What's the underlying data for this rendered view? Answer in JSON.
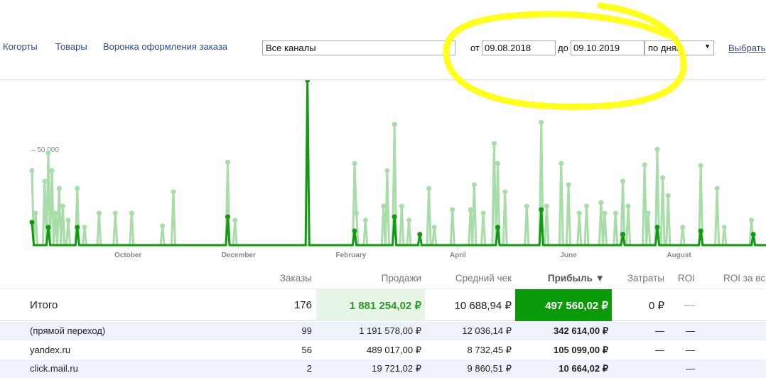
{
  "nav": {
    "items": [
      "Когорты",
      "Товары",
      "Воронка оформления заказа"
    ]
  },
  "filters": {
    "channel": "Все каналы",
    "from_label": "от",
    "from": "09.08.2018",
    "to_label": "до",
    "to": "09.10.2019",
    "granularity": "по дням",
    "select_link": "Выбрать"
  },
  "chart_data": {
    "type": "line",
    "x_unit": "days since 09.08.2018",
    "xlim": [
      0,
      405
    ],
    "ylim": [
      0,
      86000
    ],
    "y_ticks": [
      {
        "value": 50000,
        "label": "– 50 000"
      }
    ],
    "x_ticks": [
      {
        "day": 53,
        "label": "October"
      },
      {
        "day": 114,
        "label": "December"
      },
      {
        "day": 176,
        "label": "February"
      },
      {
        "day": 235,
        "label": "April"
      },
      {
        "day": 296,
        "label": "June"
      },
      {
        "day": 357,
        "label": "August"
      }
    ],
    "series": [
      {
        "name": "Продажи",
        "color": "#a8dca8",
        "points": [
          [
            0,
            38900
          ],
          [
            2,
            16700
          ],
          [
            7,
            33300
          ],
          [
            9,
            48100
          ],
          [
            11,
            38900
          ],
          [
            13,
            16700
          ],
          [
            15,
            29600
          ],
          [
            17,
            20400
          ],
          [
            20,
            13000
          ],
          [
            25,
            29600
          ],
          [
            29,
            9300
          ],
          [
            37,
            16700
          ],
          [
            46,
            16700
          ],
          [
            55,
            16700
          ],
          [
            72,
            10000
          ],
          [
            78,
            27800
          ],
          [
            108,
            43300
          ],
          [
            112,
            13000
          ],
          [
            178,
            42600
          ],
          [
            179,
            16700
          ],
          [
            184,
            13000
          ],
          [
            194,
            20400
          ],
          [
            196,
            38900
          ],
          [
            200,
            63000
          ],
          [
            204,
            20400
          ],
          [
            208,
            13000
          ],
          [
            219,
            29600
          ],
          [
            222,
            9300
          ],
          [
            232,
            18500
          ],
          [
            242,
            18500
          ],
          [
            244,
            31500
          ],
          [
            249,
            16700
          ],
          [
            255,
            53000
          ],
          [
            257,
            42600
          ],
          [
            261,
            27800
          ],
          [
            273,
            20400
          ],
          [
            281,
            64100
          ],
          [
            284,
            20400
          ],
          [
            292,
            42600
          ],
          [
            296,
            31500
          ],
          [
            302,
            16700
          ],
          [
            306,
            20400
          ],
          [
            314,
            22200
          ],
          [
            316,
            16700
          ],
          [
            322,
            16700
          ],
          [
            326,
            33300
          ],
          [
            329,
            20400
          ],
          [
            338,
            41900
          ],
          [
            340,
            16700
          ],
          [
            345,
            50000
          ],
          [
            348,
            35200
          ],
          [
            351,
            25900
          ],
          [
            359,
            9300
          ],
          [
            369,
            41500
          ],
          [
            378,
            29600
          ],
          [
            382,
            9300
          ],
          [
            397,
            13000
          ]
        ]
      },
      {
        "name": "Прибыль",
        "color": "#119911",
        "points": [
          [
            0,
            11900
          ],
          [
            9,
            9300
          ],
          [
            25,
            9300
          ],
          [
            108,
            14800
          ],
          [
            152,
            86000
          ],
          [
            178,
            7400
          ],
          [
            200,
            14800
          ],
          [
            214,
            5600
          ],
          [
            257,
            9300
          ],
          [
            281,
            18500
          ],
          [
            326,
            5600
          ],
          [
            345,
            9300
          ],
          [
            369,
            7400
          ],
          [
            398,
            5600
          ]
        ]
      }
    ]
  },
  "table": {
    "headers": [
      "Заказы",
      "Продажи",
      "Средний чек",
      "Прибыль ▼",
      "Затраты",
      "ROI",
      "ROI за вс"
    ],
    "total": {
      "name": "Итого",
      "orders": "176",
      "sales": "1 881 254,02 ₽",
      "avg": "10 688,94 ₽",
      "profit": "497 560,02 ₽",
      "costs": "0 ₽",
      "roi": "—"
    },
    "rows": [
      {
        "name": "(прямой переход)",
        "orders": "99",
        "sales": "1 191 578,00 ₽",
        "avg": "12 036,14 ₽",
        "profit": "342 614,00 ₽",
        "costs": "—",
        "roi": "—"
      },
      {
        "name": "yandex.ru",
        "orders": "56",
        "sales": "489 017,00 ₽",
        "avg": "8 732,45 ₽",
        "profit": "105 099,00 ₽",
        "costs": "—",
        "roi": "—"
      },
      {
        "name": "click.mail.ru",
        "orders": "2",
        "sales": "19 721,02 ₽",
        "avg": "9 860,51 ₽",
        "profit": "10 664,02 ₽",
        "costs": "",
        "roi": "—"
      }
    ]
  }
}
